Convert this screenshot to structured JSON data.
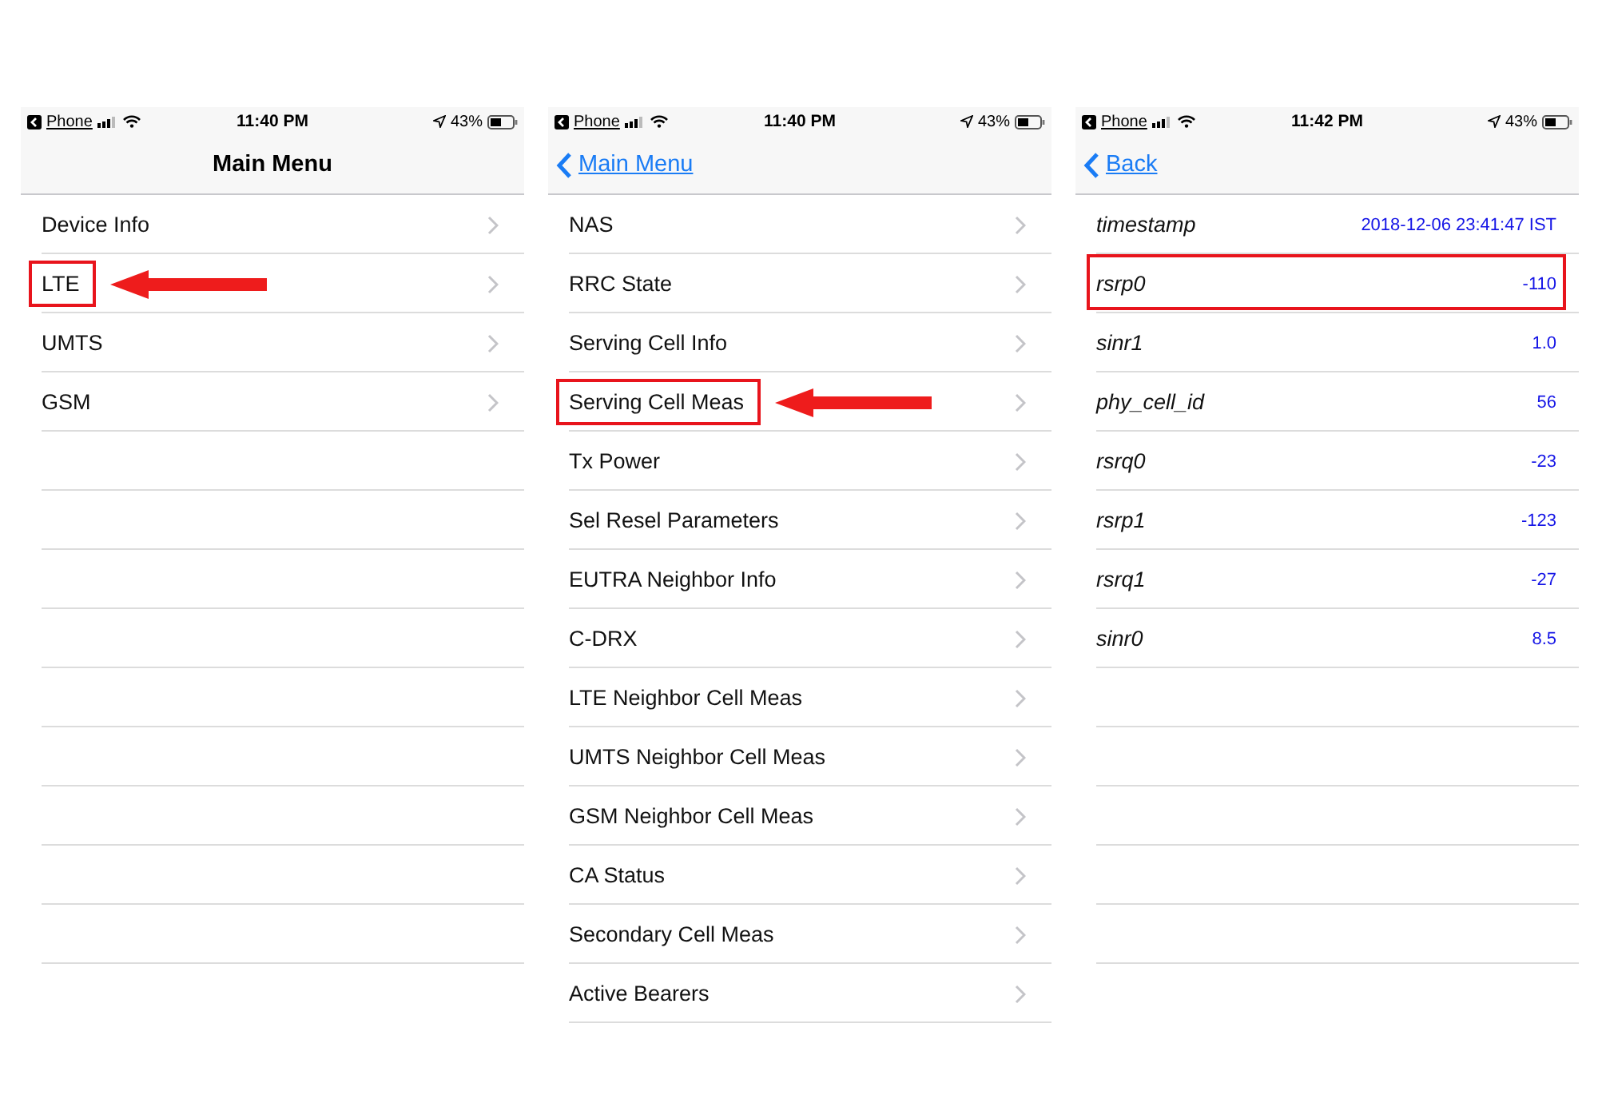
{
  "screens": [
    {
      "status": {
        "back_app": "Phone",
        "time": "11:40 PM",
        "battery": "43%"
      },
      "nav": {
        "kind": "title",
        "label": "Main Menu"
      },
      "rows": [
        {
          "kind": "menu",
          "label": "Device Info",
          "highlighted": false,
          "arrow": false
        },
        {
          "kind": "menu",
          "label": "LTE",
          "highlighted": true,
          "arrow": true
        },
        {
          "kind": "menu",
          "label": "UMTS",
          "highlighted": false,
          "arrow": false
        },
        {
          "kind": "menu",
          "label": "GSM",
          "highlighted": false,
          "arrow": false
        }
      ]
    },
    {
      "status": {
        "back_app": "Phone",
        "time": "11:40 PM",
        "battery": "43%"
      },
      "nav": {
        "kind": "back",
        "label": "Main Menu"
      },
      "rows": [
        {
          "kind": "menu",
          "label": "NAS",
          "highlighted": false,
          "arrow": false
        },
        {
          "kind": "menu",
          "label": "RRC State",
          "highlighted": false,
          "arrow": false
        },
        {
          "kind": "menu",
          "label": "Serving Cell Info",
          "highlighted": false,
          "arrow": false
        },
        {
          "kind": "menu",
          "label": "Serving Cell Meas",
          "highlighted": true,
          "arrow": true
        },
        {
          "kind": "menu",
          "label": "Tx Power",
          "highlighted": false,
          "arrow": false
        },
        {
          "kind": "menu",
          "label": "Sel Resel Parameters",
          "highlighted": false,
          "arrow": false
        },
        {
          "kind": "menu",
          "label": "EUTRA Neighbor Info",
          "highlighted": false,
          "arrow": false
        },
        {
          "kind": "menu",
          "label": "C-DRX",
          "highlighted": false,
          "arrow": false
        },
        {
          "kind": "menu",
          "label": "LTE Neighbor Cell Meas",
          "highlighted": false,
          "arrow": false
        },
        {
          "kind": "menu",
          "label": "UMTS Neighbor Cell Meas",
          "highlighted": false,
          "arrow": false
        },
        {
          "kind": "menu",
          "label": "GSM Neighbor Cell Meas",
          "highlighted": false,
          "arrow": false
        },
        {
          "kind": "menu",
          "label": "CA Status",
          "highlighted": false,
          "arrow": false
        },
        {
          "kind": "menu",
          "label": "Secondary Cell Meas",
          "highlighted": false,
          "arrow": false
        },
        {
          "kind": "menu",
          "label": "Active Bearers",
          "highlighted": false,
          "arrow": false
        }
      ]
    },
    {
      "status": {
        "back_app": "Phone",
        "time": "11:42 PM",
        "battery": "43%"
      },
      "nav": {
        "kind": "back",
        "label": "Back"
      },
      "rows": [
        {
          "kind": "field",
          "label": "timestamp",
          "value": "2018-12-06 23:41:47 IST",
          "highlighted": false,
          "arrow": false
        },
        {
          "kind": "field",
          "label": "rsrp0",
          "value": "-110",
          "highlighted": true,
          "arrow": false
        },
        {
          "kind": "field",
          "label": "sinr1",
          "value": "1.0",
          "highlighted": false,
          "arrow": false
        },
        {
          "kind": "field",
          "label": "phy_cell_id",
          "value": "56",
          "highlighted": false,
          "arrow": false
        },
        {
          "kind": "field",
          "label": "rsrq0",
          "value": "-23",
          "highlighted": false,
          "arrow": false
        },
        {
          "kind": "field",
          "label": "rsrp1",
          "value": "-123",
          "highlighted": false,
          "arrow": false
        },
        {
          "kind": "field",
          "label": "rsrq1",
          "value": "-27",
          "highlighted": false,
          "arrow": false
        },
        {
          "kind": "field",
          "label": "sinr0",
          "value": "8.5",
          "highlighted": false,
          "arrow": false
        }
      ]
    }
  ]
}
